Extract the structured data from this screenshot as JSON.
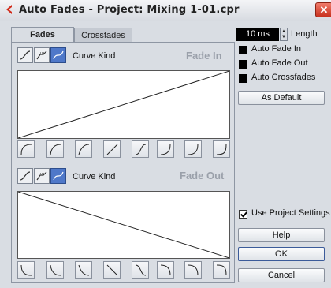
{
  "window": {
    "title": "Auto Fades - Project: Mixing 1-01.cpr",
    "close_glyph": "✕"
  },
  "tabs": [
    {
      "label": "Fades",
      "active": true
    },
    {
      "label": "Crossfades",
      "active": false
    }
  ],
  "fade_in": {
    "curve_kind_label": "Curve Kind",
    "section_title": "Fade In",
    "curve_kinds": [
      "spline",
      "damped-spline",
      "linear"
    ],
    "selected_kind": "linear",
    "presets": [
      "convex-1",
      "convex-2",
      "convex-3",
      "linear",
      "s-curve",
      "concave-1",
      "concave-2",
      "concave-3"
    ]
  },
  "fade_out": {
    "curve_kind_label": "Curve Kind",
    "section_title": "Fade Out",
    "curve_kinds": [
      "spline",
      "damped-spline",
      "linear"
    ],
    "selected_kind": "linear",
    "presets": [
      "convex-1",
      "convex-2",
      "convex-3",
      "linear",
      "s-curve",
      "concave-1",
      "concave-2",
      "concave-3"
    ]
  },
  "length": {
    "value": "10 ms",
    "label": "Length"
  },
  "options": {
    "auto_fade_in": {
      "label": "Auto Fade In",
      "checked": false
    },
    "auto_fade_out": {
      "label": "Auto Fade Out",
      "checked": false
    },
    "auto_crossfades": {
      "label": "Auto Crossfades",
      "checked": false
    }
  },
  "as_default_label": "As Default",
  "use_project_settings": {
    "label": "Use Project Settings",
    "checked": true
  },
  "buttons": {
    "help": "Help",
    "ok": "OK",
    "cancel": "Cancel"
  },
  "colors": {
    "selected_kind": "#4f78c9",
    "close": "#c8321f",
    "length_field": "#000000"
  }
}
